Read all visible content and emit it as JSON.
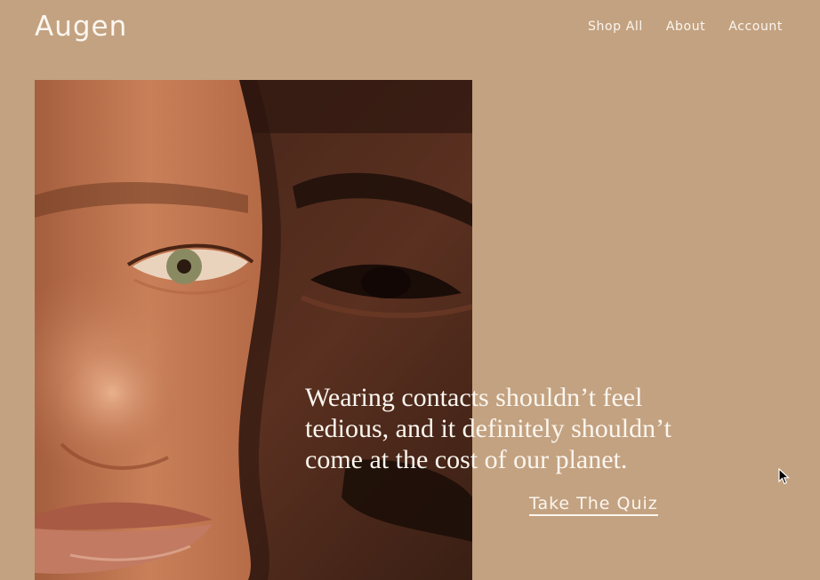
{
  "header": {
    "logo": "Augen",
    "nav": [
      {
        "label": "Shop All"
      },
      {
        "label": "About"
      },
      {
        "label": "Account"
      }
    ]
  },
  "hero": {
    "headline": "Wearing contacts shouldn’t feel tedious, and it definitely shouldn’t come at the cost of our planet.",
    "cta_label": "Take The Quiz"
  },
  "colors": {
    "background": "#c3a281",
    "text": "#fbf6ef"
  },
  "icons": {
    "cursor": "mouse-pointer-icon"
  }
}
